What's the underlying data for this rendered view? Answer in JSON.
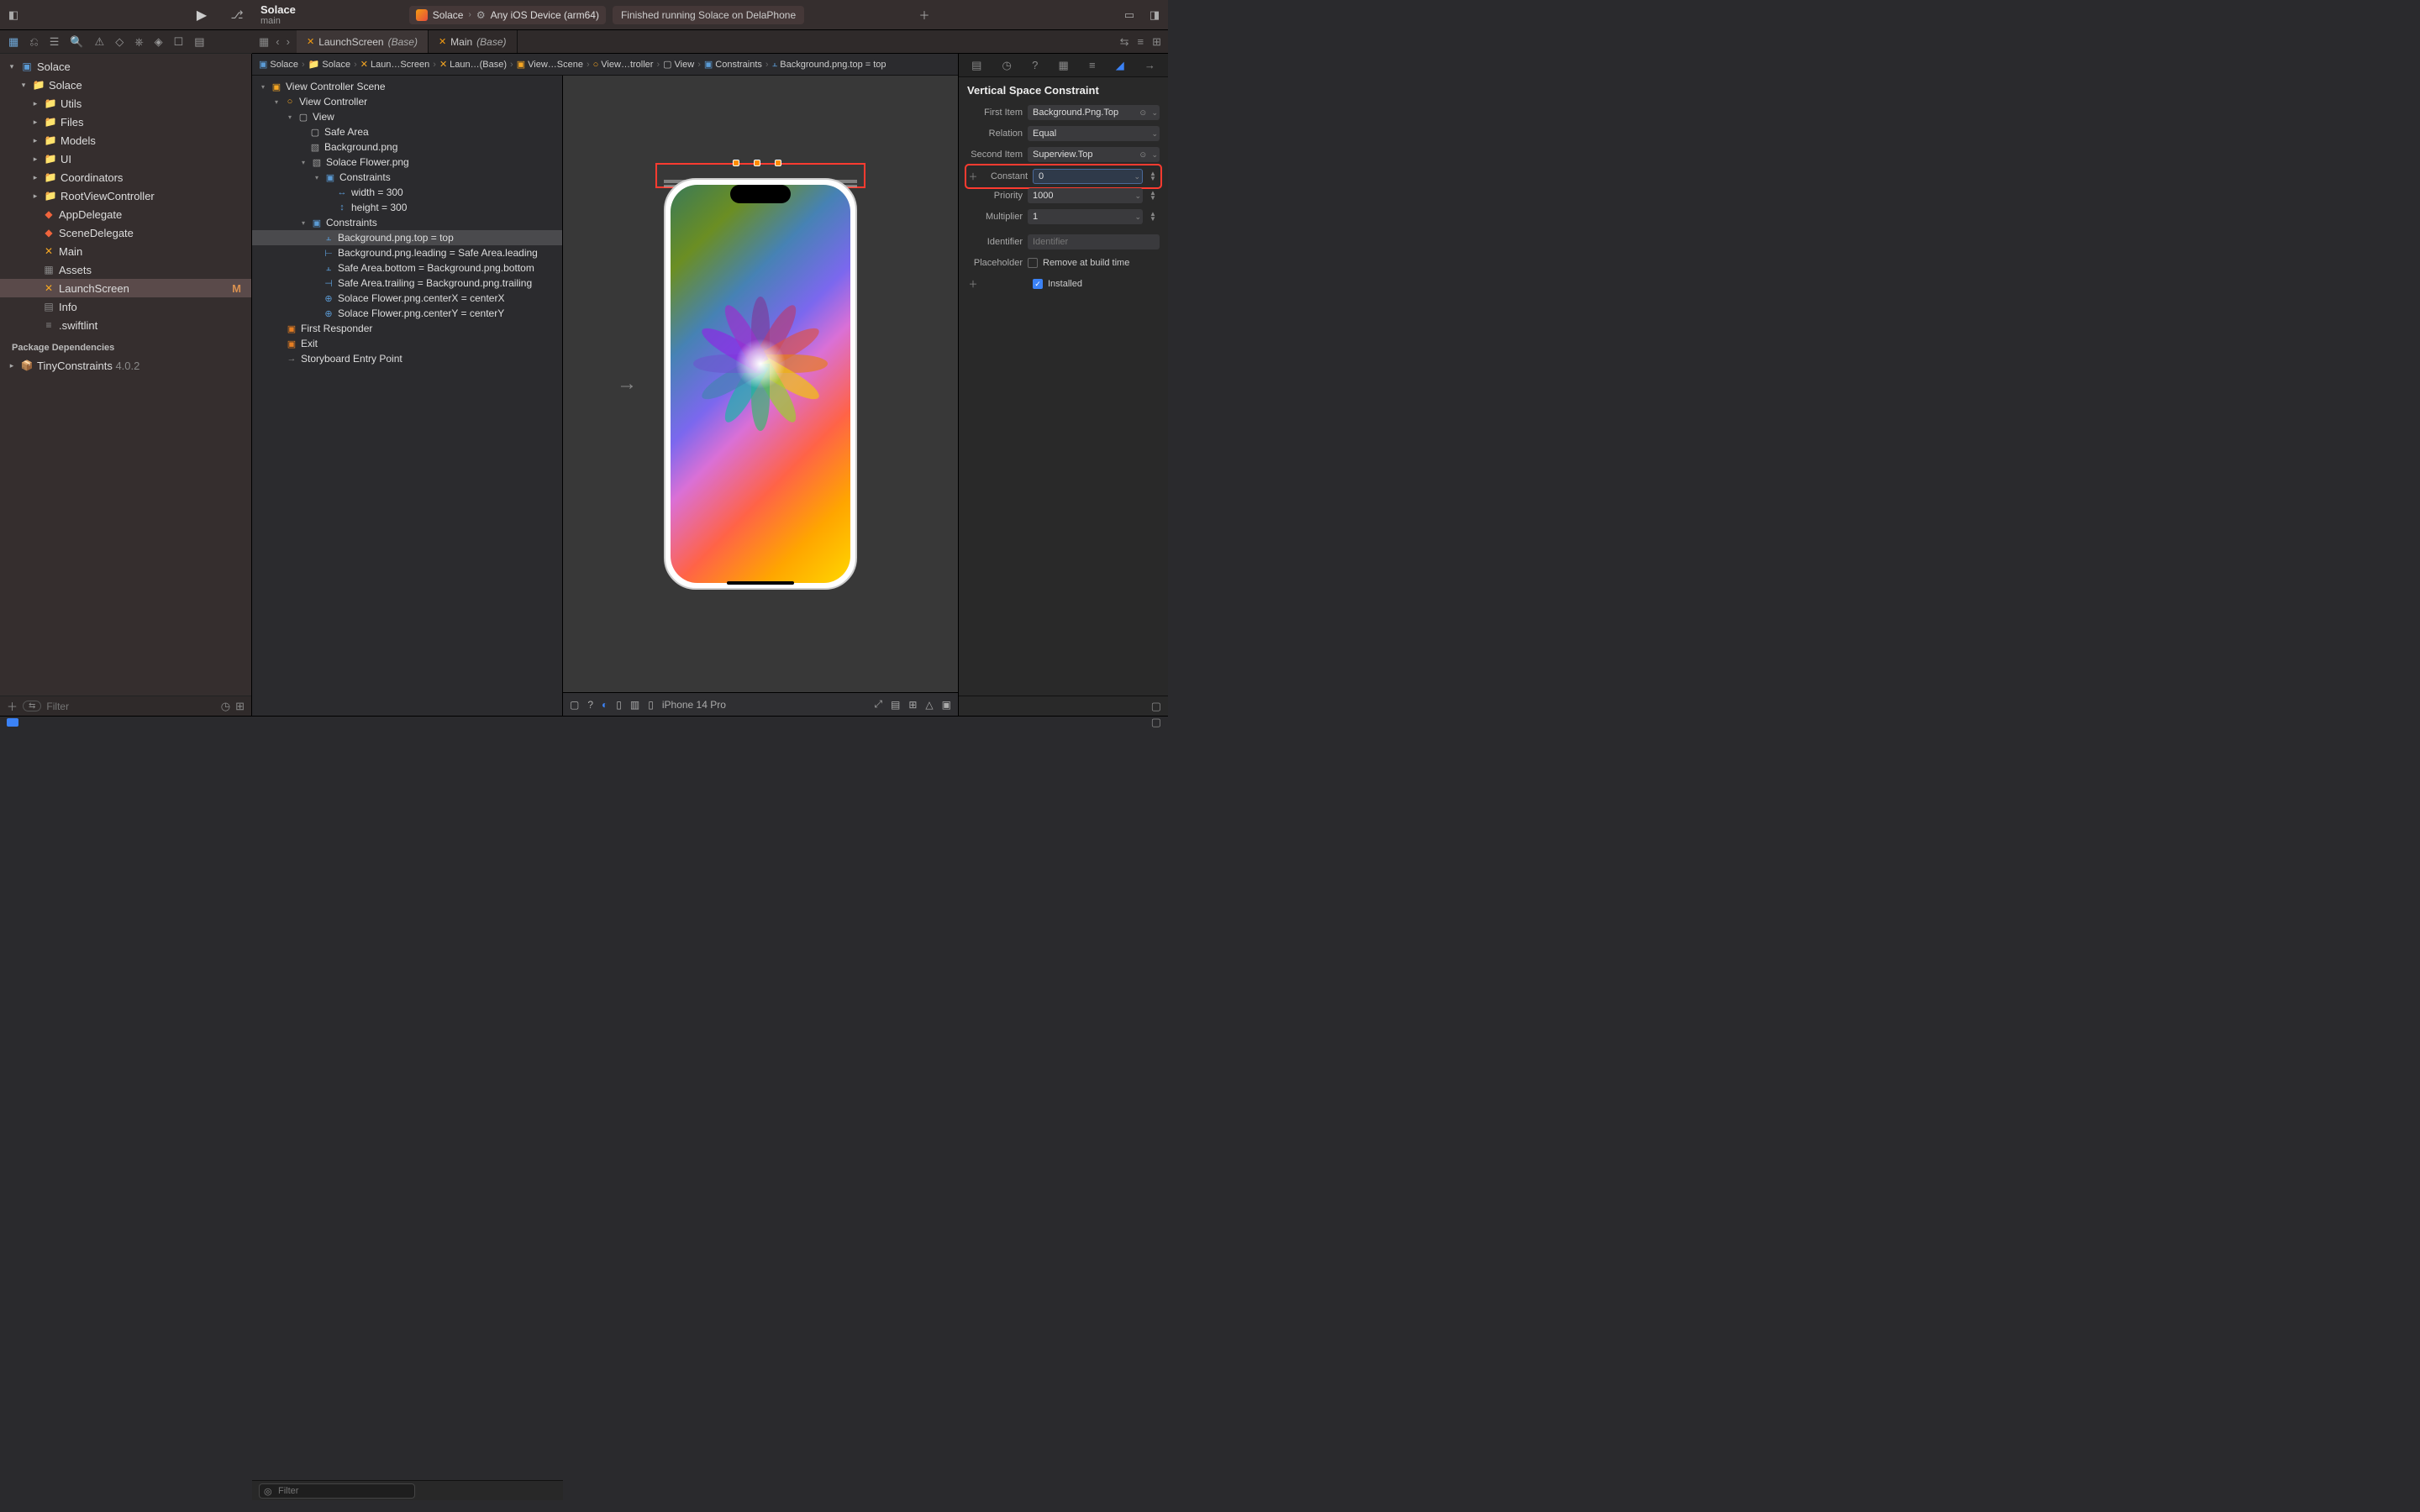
{
  "toolbar": {
    "project_name": "Solace",
    "branch": "main",
    "scheme_app": "Solace",
    "scheme_device": "Any iOS Device (arm64)",
    "status": "Finished running Solace on DelaPhone"
  },
  "tabs": [
    {
      "label": "LaunchScreen",
      "suffix": "(Base)",
      "active": true
    },
    {
      "label": "Main",
      "suffix": "(Base)",
      "active": false
    }
  ],
  "navigator": {
    "root": "Solace",
    "group": "Solace",
    "folders": [
      "Utils",
      "Files",
      "Models",
      "UI",
      "Coordinators",
      "RootViewController"
    ],
    "files": [
      {
        "name": "AppDelegate",
        "type": "swift"
      },
      {
        "name": "SceneDelegate",
        "type": "swift"
      },
      {
        "name": "Main",
        "type": "ib"
      },
      {
        "name": "Assets",
        "type": "assets"
      },
      {
        "name": "LaunchScreen",
        "type": "ib",
        "selected": true,
        "badge": "M"
      },
      {
        "name": "Info",
        "type": "plist"
      },
      {
        "name": ".swiftlint",
        "type": "text"
      }
    ],
    "package_header": "Package Dependencies",
    "packages": [
      {
        "name": "TinyConstraints",
        "version": "4.0.2"
      }
    ],
    "filter_placeholder": "Filter"
  },
  "breadcrumb": [
    "Solace",
    "Solace",
    "Laun…Screen",
    "Laun…(Base)",
    "View…Scene",
    "View…troller",
    "View",
    "Constraints",
    "Background.png.top = top"
  ],
  "outline": {
    "scene": "View Controller Scene",
    "vc": "View Controller",
    "view": "View",
    "safe_area": "Safe Area",
    "bg": "Background.png",
    "flower": "Solace Flower.png",
    "flower_constraints_header": "Constraints",
    "flower_constraints": [
      "width = 300",
      "height = 300"
    ],
    "view_constraints_header": "Constraints",
    "view_constraints": [
      "Background.png.top = top",
      "Background.png.leading = Safe Area.leading",
      "Safe Area.bottom = Background.png.bottom",
      "Safe Area.trailing = Background.png.trailing",
      "Solace Flower.png.centerX = centerX",
      "Solace Flower.png.centerY = centerY"
    ],
    "first_responder": "First Responder",
    "exit": "Exit",
    "entry": "Storyboard Entry Point",
    "filter_placeholder": "Filter"
  },
  "canvas": {
    "device_label": "iPhone 14 Pro"
  },
  "inspector": {
    "title": "Vertical Space Constraint",
    "first_item_label": "First Item",
    "first_item": "Background.Png.Top",
    "relation_label": "Relation",
    "relation": "Equal",
    "second_item_label": "Second Item",
    "second_item": "Superview.Top",
    "constant_label": "Constant",
    "constant": "0",
    "priority_label": "Priority",
    "priority": "1000",
    "multiplier_label": "Multiplier",
    "multiplier": "1",
    "identifier_label": "Identifier",
    "identifier_placeholder": "Identifier",
    "placeholder_label": "Placeholder",
    "placeholder_chk": "Remove at build time",
    "installed": "Installed"
  }
}
